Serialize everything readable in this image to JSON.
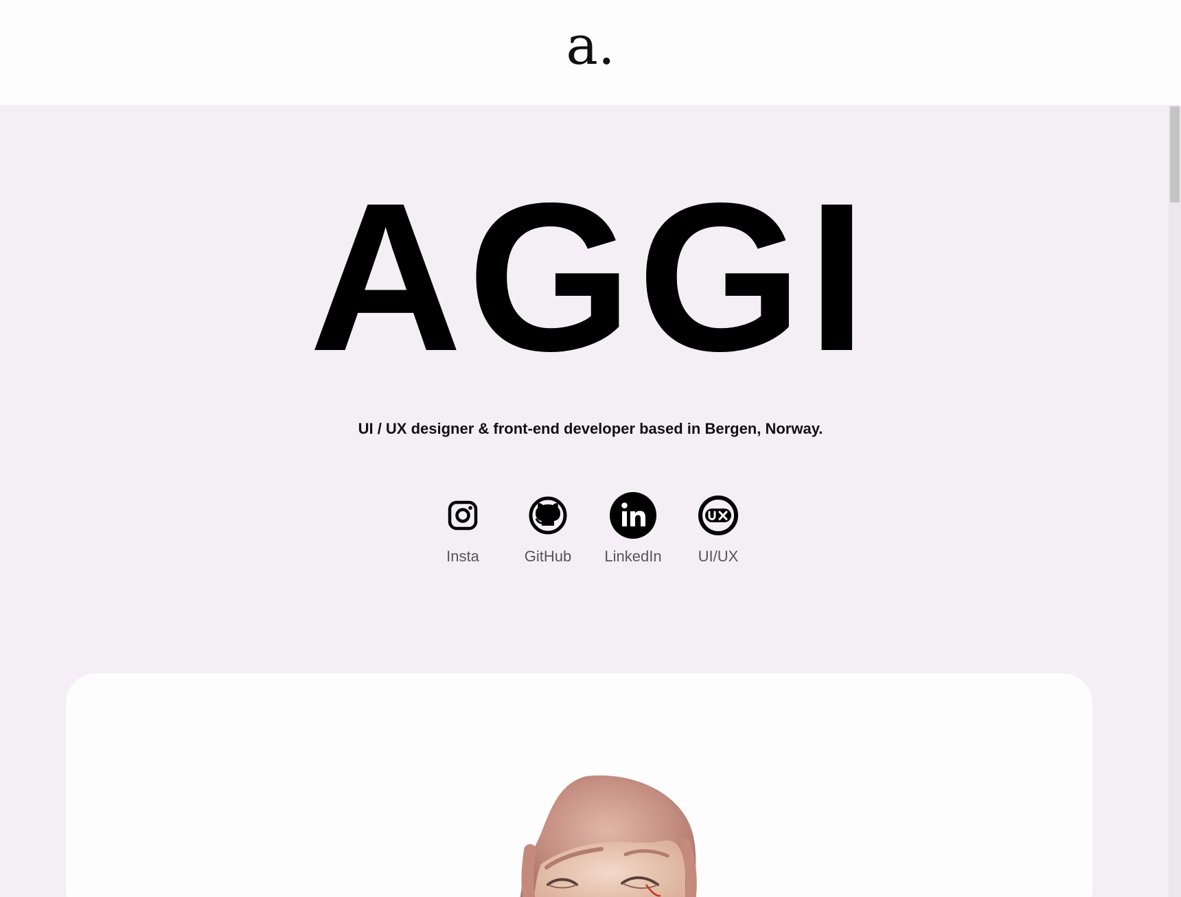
{
  "header": {
    "logo_text": "a."
  },
  "hero": {
    "title": "AGGI",
    "tagline": "UI / UX designer & front-end developer based in Bergen, Norway."
  },
  "socials": [
    {
      "label": "Insta",
      "icon": "instagram-icon"
    },
    {
      "label": "GitHub",
      "icon": "github-icon"
    },
    {
      "label": "LinkedIn",
      "icon": "linkedin-icon"
    },
    {
      "label": "UI/UX",
      "icon": "uxcollective-icon"
    }
  ],
  "colors": {
    "background": "#f4eff5",
    "header_bg": "#fdfdfd",
    "text": "#000000",
    "muted_text": "#555555"
  }
}
